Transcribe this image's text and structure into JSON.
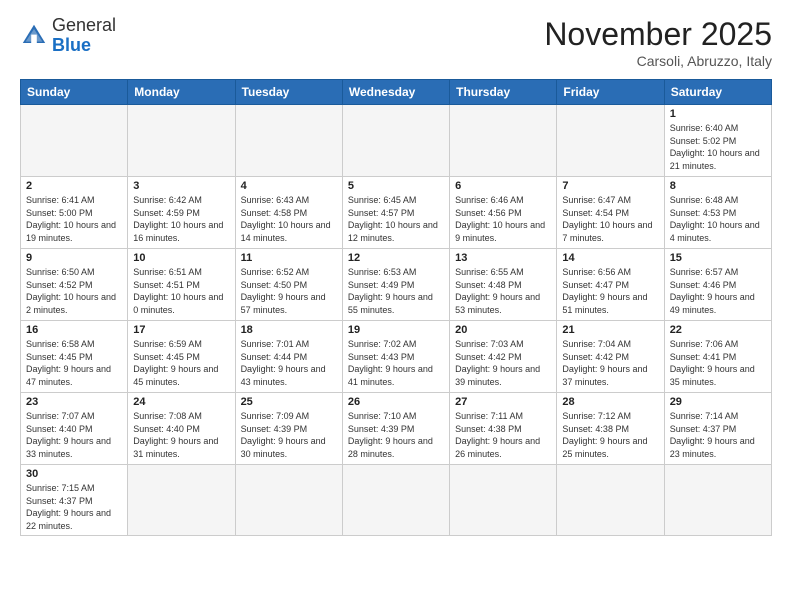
{
  "header": {
    "logo_general": "General",
    "logo_blue": "Blue",
    "month_year": "November 2025",
    "location": "Carsoli, Abruzzo, Italy"
  },
  "days_of_week": [
    "Sunday",
    "Monday",
    "Tuesday",
    "Wednesday",
    "Thursday",
    "Friday",
    "Saturday"
  ],
  "weeks": [
    [
      {
        "day": "",
        "info": ""
      },
      {
        "day": "",
        "info": ""
      },
      {
        "day": "",
        "info": ""
      },
      {
        "day": "",
        "info": ""
      },
      {
        "day": "",
        "info": ""
      },
      {
        "day": "",
        "info": ""
      },
      {
        "day": "1",
        "info": "Sunrise: 6:40 AM\nSunset: 5:02 PM\nDaylight: 10 hours and 21 minutes."
      }
    ],
    [
      {
        "day": "2",
        "info": "Sunrise: 6:41 AM\nSunset: 5:00 PM\nDaylight: 10 hours and 19 minutes."
      },
      {
        "day": "3",
        "info": "Sunrise: 6:42 AM\nSunset: 4:59 PM\nDaylight: 10 hours and 16 minutes."
      },
      {
        "day": "4",
        "info": "Sunrise: 6:43 AM\nSunset: 4:58 PM\nDaylight: 10 hours and 14 minutes."
      },
      {
        "day": "5",
        "info": "Sunrise: 6:45 AM\nSunset: 4:57 PM\nDaylight: 10 hours and 12 minutes."
      },
      {
        "day": "6",
        "info": "Sunrise: 6:46 AM\nSunset: 4:56 PM\nDaylight: 10 hours and 9 minutes."
      },
      {
        "day": "7",
        "info": "Sunrise: 6:47 AM\nSunset: 4:54 PM\nDaylight: 10 hours and 7 minutes."
      },
      {
        "day": "8",
        "info": "Sunrise: 6:48 AM\nSunset: 4:53 PM\nDaylight: 10 hours and 4 minutes."
      }
    ],
    [
      {
        "day": "9",
        "info": "Sunrise: 6:50 AM\nSunset: 4:52 PM\nDaylight: 10 hours and 2 minutes."
      },
      {
        "day": "10",
        "info": "Sunrise: 6:51 AM\nSunset: 4:51 PM\nDaylight: 10 hours and 0 minutes."
      },
      {
        "day": "11",
        "info": "Sunrise: 6:52 AM\nSunset: 4:50 PM\nDaylight: 9 hours and 57 minutes."
      },
      {
        "day": "12",
        "info": "Sunrise: 6:53 AM\nSunset: 4:49 PM\nDaylight: 9 hours and 55 minutes."
      },
      {
        "day": "13",
        "info": "Sunrise: 6:55 AM\nSunset: 4:48 PM\nDaylight: 9 hours and 53 minutes."
      },
      {
        "day": "14",
        "info": "Sunrise: 6:56 AM\nSunset: 4:47 PM\nDaylight: 9 hours and 51 minutes."
      },
      {
        "day": "15",
        "info": "Sunrise: 6:57 AM\nSunset: 4:46 PM\nDaylight: 9 hours and 49 minutes."
      }
    ],
    [
      {
        "day": "16",
        "info": "Sunrise: 6:58 AM\nSunset: 4:45 PM\nDaylight: 9 hours and 47 minutes."
      },
      {
        "day": "17",
        "info": "Sunrise: 6:59 AM\nSunset: 4:45 PM\nDaylight: 9 hours and 45 minutes."
      },
      {
        "day": "18",
        "info": "Sunrise: 7:01 AM\nSunset: 4:44 PM\nDaylight: 9 hours and 43 minutes."
      },
      {
        "day": "19",
        "info": "Sunrise: 7:02 AM\nSunset: 4:43 PM\nDaylight: 9 hours and 41 minutes."
      },
      {
        "day": "20",
        "info": "Sunrise: 7:03 AM\nSunset: 4:42 PM\nDaylight: 9 hours and 39 minutes."
      },
      {
        "day": "21",
        "info": "Sunrise: 7:04 AM\nSunset: 4:42 PM\nDaylight: 9 hours and 37 minutes."
      },
      {
        "day": "22",
        "info": "Sunrise: 7:06 AM\nSunset: 4:41 PM\nDaylight: 9 hours and 35 minutes."
      }
    ],
    [
      {
        "day": "23",
        "info": "Sunrise: 7:07 AM\nSunset: 4:40 PM\nDaylight: 9 hours and 33 minutes."
      },
      {
        "day": "24",
        "info": "Sunrise: 7:08 AM\nSunset: 4:40 PM\nDaylight: 9 hours and 31 minutes."
      },
      {
        "day": "25",
        "info": "Sunrise: 7:09 AM\nSunset: 4:39 PM\nDaylight: 9 hours and 30 minutes."
      },
      {
        "day": "26",
        "info": "Sunrise: 7:10 AM\nSunset: 4:39 PM\nDaylight: 9 hours and 28 minutes."
      },
      {
        "day": "27",
        "info": "Sunrise: 7:11 AM\nSunset: 4:38 PM\nDaylight: 9 hours and 26 minutes."
      },
      {
        "day": "28",
        "info": "Sunrise: 7:12 AM\nSunset: 4:38 PM\nDaylight: 9 hours and 25 minutes."
      },
      {
        "day": "29",
        "info": "Sunrise: 7:14 AM\nSunset: 4:37 PM\nDaylight: 9 hours and 23 minutes."
      }
    ],
    [
      {
        "day": "30",
        "info": "Sunrise: 7:15 AM\nSunset: 4:37 PM\nDaylight: 9 hours and 22 minutes."
      },
      {
        "day": "",
        "info": ""
      },
      {
        "day": "",
        "info": ""
      },
      {
        "day": "",
        "info": ""
      },
      {
        "day": "",
        "info": ""
      },
      {
        "day": "",
        "info": ""
      },
      {
        "day": "",
        "info": ""
      }
    ]
  ]
}
